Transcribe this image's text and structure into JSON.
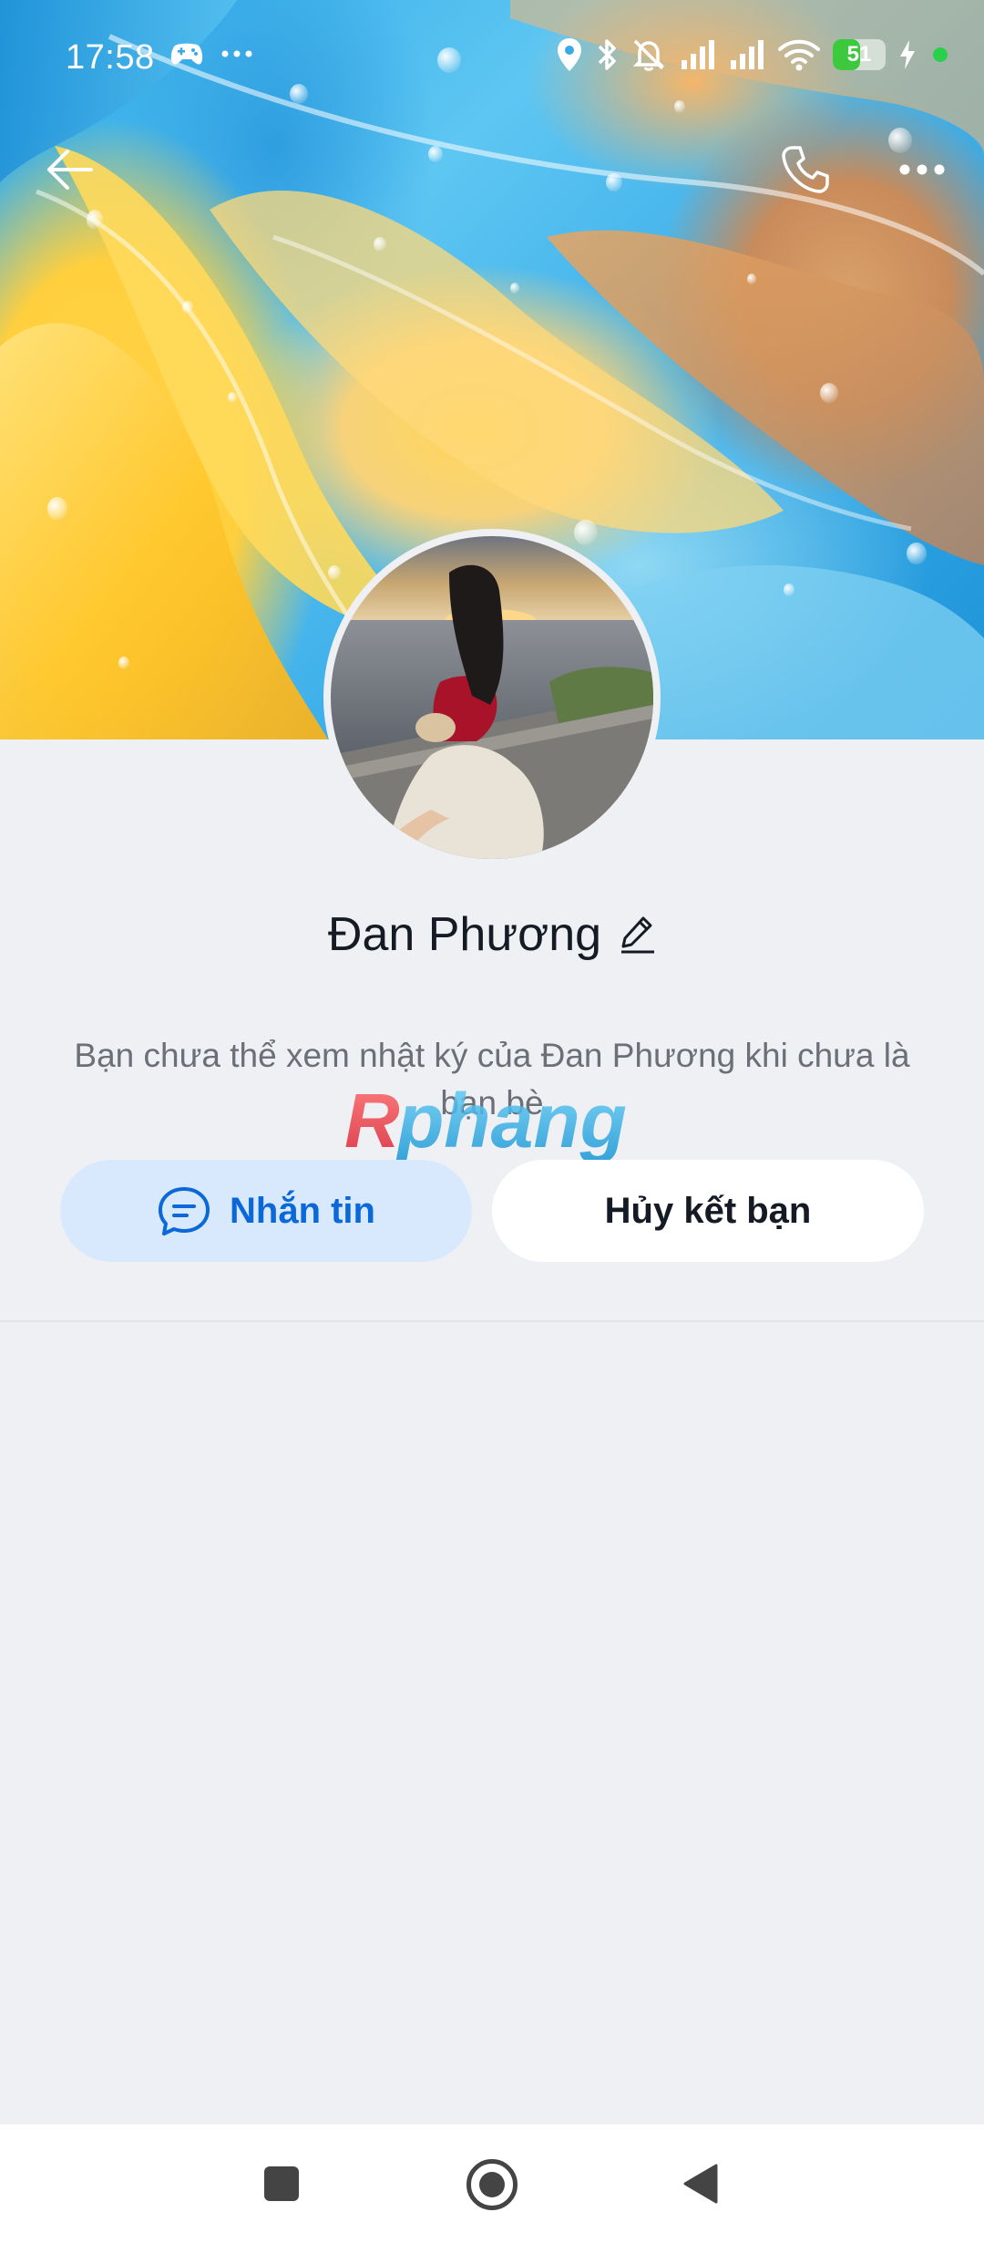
{
  "status_bar": {
    "time": "17:58",
    "left_icons": [
      "game-controller-icon",
      "more-dots-icon"
    ],
    "right_icons": [
      "location-icon",
      "bluetooth-icon",
      "mute-icon",
      "signal-icon",
      "signal-icon",
      "wifi-icon",
      "battery-icon",
      "charging-icon"
    ],
    "battery_level": "51",
    "battery_fraction": 0.51
  },
  "top_nav": {
    "back_icon": "arrow-left-icon",
    "call_icon": "phone-icon",
    "more_icon": "more-horizontal-icon"
  },
  "profile": {
    "name": "Đan Phương",
    "edit_icon": "pencil-icon",
    "notice": "Bạn chưa thể xem nhật ký của Đan Phương khi chưa là bạn bè"
  },
  "watermark": "Rphang",
  "actions": {
    "message_label": "Nhắn tin",
    "message_icon": "chat-bubble-icon",
    "unfriend_label": "Hủy kết bạn"
  },
  "colors": {
    "accent": "#0a68d8",
    "message_button_bg": "#d8e9fd",
    "page_bg": "#eff0f4"
  },
  "nav_bar": {
    "icons": [
      "recent-apps-icon",
      "home-icon",
      "back-icon"
    ]
  }
}
